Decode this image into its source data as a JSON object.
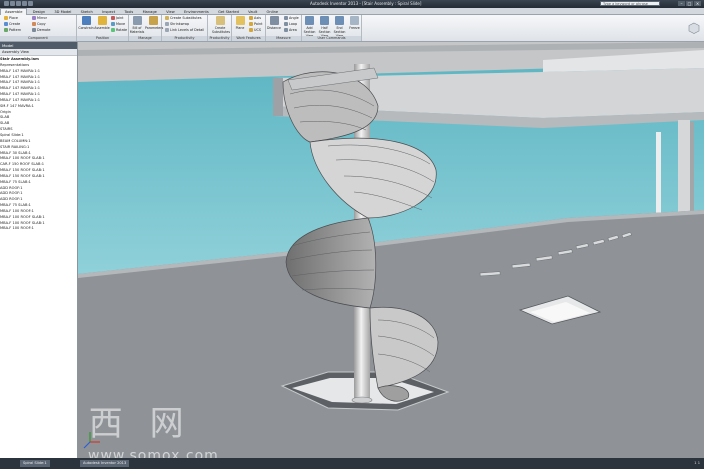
{
  "app": {
    "title": "Autodesk Inventor 2013 - [Stair Assembly : Spiral Slide]",
    "search_placeholder": "Type a keyword or phrase",
    "window_buttons": [
      "–",
      "□",
      "×"
    ]
  },
  "ribbon": {
    "tabs": [
      "Assemble",
      "Design",
      "3D Model",
      "Sketch",
      "Inspect",
      "Tools",
      "Manage",
      "View",
      "Environments",
      "Get Started",
      "Vault",
      "Online"
    ],
    "active_tab": "Assemble",
    "panels": {
      "component": {
        "label": "Component",
        "buttons": [
          "Place",
          "Create",
          "Pattern",
          "Mirror",
          "Copy",
          "Demote"
        ]
      },
      "position": {
        "label": "Position",
        "buttons": [
          "Constrain",
          "Assemble",
          "Joint",
          "Move",
          "Rotate"
        ]
      },
      "manage": {
        "label": "Manage",
        "buttons": [
          "Bill of Materials",
          "Parameters"
        ]
      },
      "productivity": {
        "label": "Productivity",
        "buttons": [
          "Create Substitutes",
          "Shrinkwrap",
          "Link Levels of Detail"
        ]
      },
      "relationships": {
        "label": "Productivity",
        "buttons": [
          "Create Substitutes"
        ]
      },
      "work_features": {
        "label": "Work Features",
        "buttons": [
          "Plane",
          "Axis",
          "Point",
          "UCS"
        ]
      },
      "measure": {
        "label": "Measure",
        "buttons": [
          "Distance",
          "Angle",
          "Loop",
          "Area"
        ]
      },
      "user_commands": {
        "label": "User Commands",
        "buttons": [
          "Add Section View",
          "Half Section View",
          "End Section View",
          "Freeze"
        ]
      }
    }
  },
  "browser": {
    "header": "Model",
    "filter": "Assembly View",
    "root": "Stair Assembly.iam",
    "items": [
      "Representations",
      "MBA-F 147 MAVRA:1:1",
      "MBA-F 147 MAVRA:1:1",
      "MBA-F 147 MAVRA:1:1",
      "MBA-F 147 MAVRA:1:1",
      "MBA-F 147 MAVRA:1:1",
      "MBA-F 147 MAVRA:1:1",
      "SM-F 147 MAVRA:1",
      "Origin",
      "SLAB",
      "SLAB",
      "STAIRS",
      "Spiral Slide:1",
      "BEAM COLUMN:1",
      "STAIR RAILING:1",
      "MBA-F 30 SLAB:1",
      "MBA-F 100 ROOF SLAB:1",
      "CAR-F 150 ROOF SLAB:1",
      "MBA-F 150 ROOF SLAB:1",
      "MBA-F 150 ROOF SLAB:1",
      "MBA-F 75 SLAB:1",
      "ADD ROOF:1",
      "ADD ROOF:1",
      "ADD ROOF:1",
      "MBA-F 75 SLAB:1",
      "MBA-F 100 ROOF:1",
      "MBA-F 100 ROOF SLAB:1",
      "MBA-F 100 ROOF SLAB:1",
      "MBA-F 100 ROOF:1"
    ]
  },
  "status_bar": {
    "tabs": [
      "Spiral Slide:1",
      "Autodesk Inventor 2013"
    ],
    "counts": "1   1"
  },
  "watermark": {
    "chars": "莫 西 网",
    "url": "www.somox.com"
  },
  "colors": {
    "sky": "#64b9c6",
    "floor": "#8f9398",
    "slide": "#c8c8c8"
  }
}
